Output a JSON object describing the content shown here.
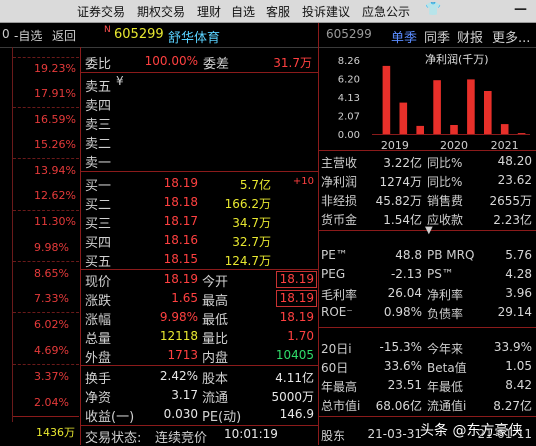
{
  "menu": {
    "items": [
      "证券交易",
      "期权交易",
      "理财",
      "自选",
      "客服",
      "投诉建议",
      "应急公示"
    ],
    "icons": [
      "shirt-icon",
      "minimize-icon"
    ]
  },
  "subbar": {
    "left_partial": "0",
    "zixuan": "-自选",
    "back": "返回",
    "flag": "N",
    "code": "605299",
    "name": "舒华体育"
  },
  "scale": {
    "ticks": [
      "19.23%",
      "17.91%",
      "16.59%",
      "15.26%",
      "13.94%",
      "12.62%",
      "11.30%",
      "9.98%",
      "8.65%",
      "7.33%",
      "6.02%",
      "4.69%",
      "3.37%",
      "2.04%"
    ],
    "volume": "1436万"
  },
  "order_book": {
    "weibi_label": "委比",
    "weibi_value": "100.00%",
    "weicha_label": "委差",
    "weicha_value": "31.7万",
    "asks": [
      {
        "label": "卖五",
        "price": "",
        "vol": "",
        "mark": "¥"
      },
      {
        "label": "卖四",
        "price": "",
        "vol": ""
      },
      {
        "label": "卖三",
        "price": "",
        "vol": ""
      },
      {
        "label": "卖二",
        "price": "",
        "vol": ""
      },
      {
        "label": "卖一",
        "price": "",
        "vol": ""
      }
    ],
    "bids": [
      {
        "label": "买一",
        "price": "18.19",
        "vol": "5.7亿",
        "chg": "+10"
      },
      {
        "label": "买二",
        "price": "18.18",
        "vol": "166.2万"
      },
      {
        "label": "买三",
        "price": "18.17",
        "vol": "34.7万"
      },
      {
        "label": "买四",
        "price": "18.16",
        "vol": "32.7万"
      },
      {
        "label": "买五",
        "price": "18.15",
        "vol": "124.7万"
      }
    ]
  },
  "quote": {
    "rows": [
      {
        "l1": "现价",
        "v1": "18.19",
        "l2": "今开",
        "v2": "18.19"
      },
      {
        "l1": "涨跌",
        "v1": "1.65",
        "l2": "最高",
        "v2": "18.19"
      },
      {
        "l1": "涨幅",
        "v1": "9.98%",
        "l2": "最低",
        "v2": "18.19"
      },
      {
        "l1": "总量",
        "v1": "12118",
        "l2": "量比",
        "v2": "1.70"
      },
      {
        "l1": "外盘",
        "v1": "1713",
        "l2": "内盘",
        "v2": "10405"
      },
      {
        "l1": "换手",
        "v1": "2.42%",
        "l2": "股本",
        "v2": "4.11亿"
      },
      {
        "l1": "净资",
        "v1": "3.17",
        "l2": "流通",
        "v2": "5000万"
      },
      {
        "l1": "收益(一)",
        "v1": "0.030",
        "l2": "PE(动)",
        "v2": "146.9"
      }
    ],
    "status_label": "交易状态:",
    "status_value": "连续竞价",
    "status_time": "10:01:19"
  },
  "fin": {
    "code": "605299",
    "tabs": [
      "单季",
      "同季",
      "财报",
      "更多..."
    ],
    "chart_title": "净利润(千万)",
    "rows": [
      {
        "l1": "主营收",
        "v1": "3.22亿",
        "l2": "同比%",
        "v2": "48.20"
      },
      {
        "l1": "净利润",
        "v1": "1274万",
        "l2": "同比%",
        "v2": "23.62"
      },
      {
        "l1": "非经损",
        "v1": "45.82万",
        "l2": "销售费",
        "v2": "2655万"
      },
      {
        "l1": "货币金",
        "v1": "1.54亿",
        "l2": "应收款",
        "v2": "2.23亿"
      },
      {
        "l1": "PE™",
        "v1": "48.8",
        "l2": "PB MRQ",
        "v2": "5.76"
      },
      {
        "l1": "PEG",
        "v1": "-2.13",
        "l2": "PS™",
        "v2": "4.28"
      },
      {
        "l1": "毛利率",
        "v1": "26.04",
        "l2": "净利率",
        "v2": "3.96"
      },
      {
        "l1": "ROE⁻",
        "v1": "0.98%",
        "l2": "负债率",
        "v2": "29.14"
      },
      {
        "l1": "20日i",
        "v1": "-15.3%",
        "l2": "今年来",
        "v2": "33.9%"
      },
      {
        "l1": "60日",
        "v1": "33.6%",
        "l2": "Beta值",
        "v2": "1.05"
      },
      {
        "l1": "年最高",
        "v1": "23.51",
        "l2": "年最低",
        "v2": "8.42"
      },
      {
        "l1": "总市值i",
        "v1": "68.06亿",
        "l2": "流通值i",
        "v2": "8.27亿"
      },
      {
        "l1": "股东",
        "v1": "21-03-31",
        "l2": "",
        "v2": "21-01-11"
      }
    ]
  },
  "chart_data": {
    "type": "bar",
    "title": "净利润(千万)",
    "yticks": [
      "8.26",
      "6.20",
      "4.13",
      "2.07",
      "0.00"
    ],
    "ylim": [
      0,
      8.26
    ],
    "xticks": [
      "2019",
      "2020",
      "2021"
    ],
    "values": [
      7.6,
      3.5,
      0.9,
      6.0,
      1.0,
      6.1,
      4.8,
      1.1,
      0.1
    ],
    "colors": {
      "bar": "#e8302a",
      "axis": "#8b1b1b"
    }
  },
  "watermark": "头条 @东方豪侠"
}
